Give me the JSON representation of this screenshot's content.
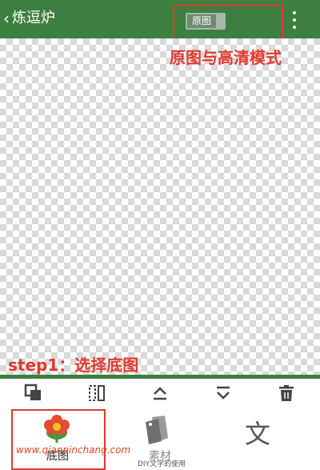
{
  "header": {
    "back_label": "炼逗炉",
    "toggle_label": "原图"
  },
  "annotations": {
    "top": "原图与高清模式",
    "bottom": "step1：选择底图"
  },
  "toolbar": {
    "tools": [
      "layer-copy",
      "flip",
      "move-up",
      "move-down",
      "delete"
    ]
  },
  "tabs": [
    {
      "label": "底图"
    },
    {
      "label": "素材"
    },
    {
      "label": "文"
    }
  ],
  "watermark": "www.qianpinchang.com",
  "caption": "DIY文字的使用",
  "colors": {
    "primary_green": "#3d7e41",
    "annotation_red": "#e03a2f"
  }
}
